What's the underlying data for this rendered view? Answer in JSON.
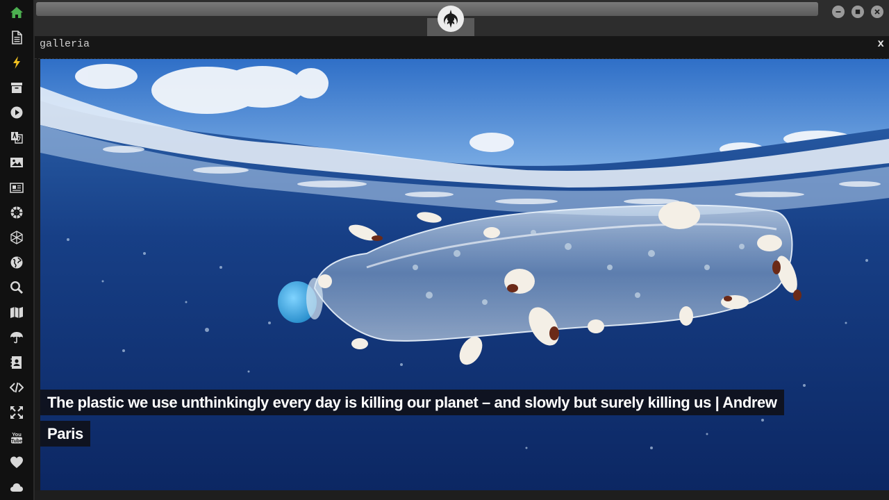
{
  "sidebar": {
    "items": [
      {
        "name": "home-icon",
        "active": true
      },
      {
        "name": "document-icon"
      },
      {
        "name": "lightning-icon"
      },
      {
        "name": "archive-icon"
      },
      {
        "name": "play-icon"
      },
      {
        "name": "translate-icon"
      },
      {
        "name": "image-icon"
      },
      {
        "name": "newspaper-icon"
      },
      {
        "name": "rebel-icon"
      },
      {
        "name": "hexagon-network-icon"
      },
      {
        "name": "globe-icon"
      },
      {
        "name": "search-icon"
      },
      {
        "name": "map-icon"
      },
      {
        "name": "umbrella-icon"
      },
      {
        "name": "contact-book-icon"
      },
      {
        "name": "code-icon"
      },
      {
        "name": "expand-arrows-icon"
      },
      {
        "name": "youtube-icon"
      },
      {
        "name": "heart-icon"
      },
      {
        "name": "cloud-icon"
      }
    ]
  },
  "topbar": {
    "logo": "rebel-alliance-logo",
    "window_controls": [
      "minimize-icon",
      "maximize-icon",
      "close-icon"
    ]
  },
  "gallery": {
    "title": "galleria",
    "close_label": "x",
    "caption": "The plastic we use unthinkingly every day is killing our planet – and slowly but surely killing us | Andrew Paris"
  },
  "colors": {
    "active_icon": "#4caf50",
    "sidebar_bg": "#111111",
    "topbar_bg": "#2d2d2d"
  }
}
